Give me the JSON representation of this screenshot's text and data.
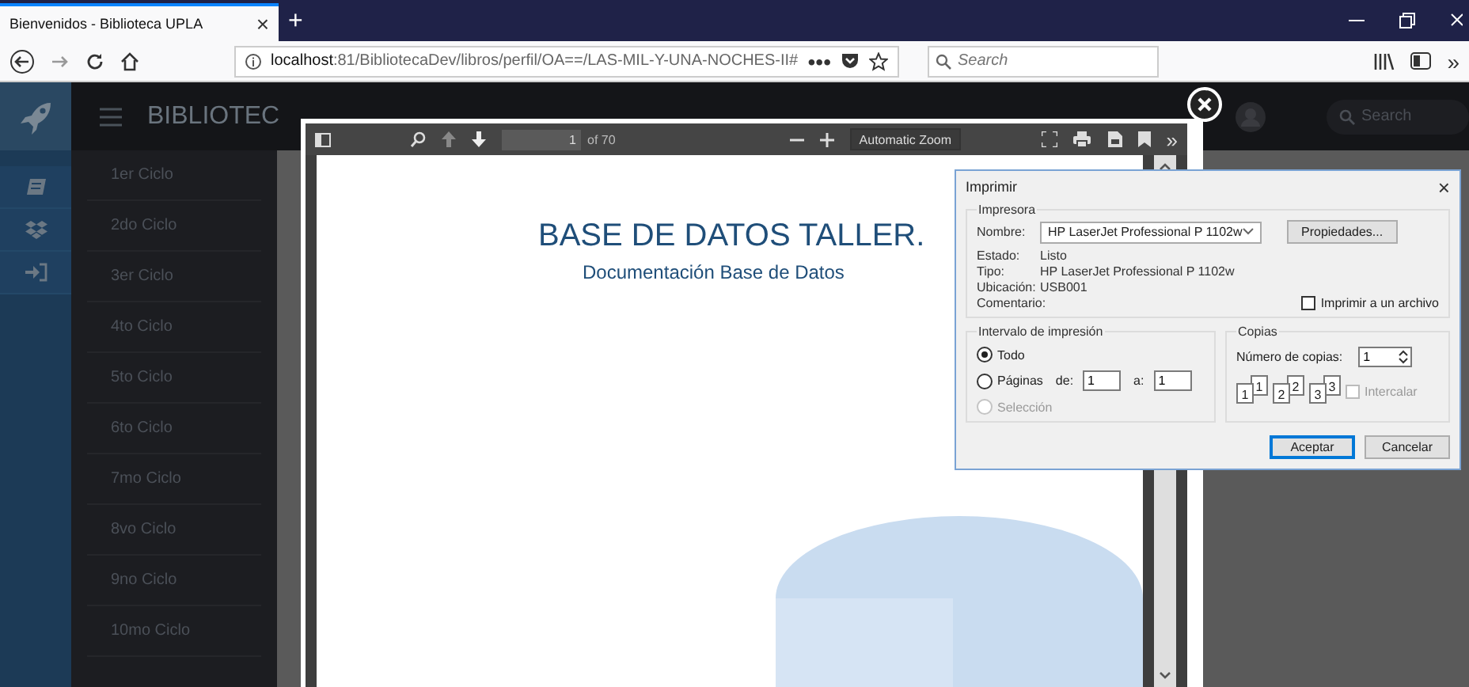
{
  "browser": {
    "tab": {
      "title": "Bienvenidos - Biblioteca UPLA",
      "close": "×"
    },
    "new_tab": "+",
    "url": "**localhost**:81/BibliotecaDev/libros/perfil/OA==/LAS-MIL-Y-UNA-NOCHES-II#",
    "more": "•••",
    "search": {
      "placeholder": "Search"
    },
    "overflow": "»"
  },
  "app": {
    "brand": "BIBLIOTEC",
    "search": {
      "placeholder": "Search"
    },
    "sidebar": {
      "items": [
        {
          "label": "1er Ciclo"
        },
        {
          "label": "2do Ciclo"
        },
        {
          "label": "3er Ciclo"
        },
        {
          "label": "4to Ciclo"
        },
        {
          "label": "5to Ciclo"
        },
        {
          "label": "6to Ciclo"
        },
        {
          "label": "7mo Ciclo"
        },
        {
          "label": "8vo Ciclo"
        },
        {
          "label": "9no Ciclo"
        },
        {
          "label": "10mo Ciclo"
        }
      ]
    }
  },
  "pdf_viewer": {
    "page_number": "1",
    "page_count": "of 70",
    "zoom": "Automatic Zoom",
    "more": "»",
    "document": {
      "title": "BASE DE DATOS TALLER.",
      "subtitle": "Documentación Base de Datos"
    }
  },
  "print_dialog": {
    "title": "Imprimir",
    "close": "×",
    "printer": {
      "group": "Impresora",
      "name_label": "Nombre:",
      "name": "HP LaserJet Professional P 1102w",
      "properties_button": "Propiedades...",
      "info": [
        {
          "label": "Estado:",
          "value": "Listo"
        },
        {
          "label": "Tipo:",
          "value": "HP LaserJet Professional P 1102w"
        },
        {
          "label": "Ubicación:",
          "value": "USB001"
        },
        {
          "label": "Comentario:"
        }
      ],
      "print_to_file": {
        "label": "Imprimir a un archivo",
        "checked": false
      }
    },
    "range": {
      "group": "Intervalo de impresión",
      "options": [
        {
          "label": "Todo",
          "selected": true,
          "disabled": false
        },
        {
          "label": "Páginas",
          "selected": false,
          "disabled": false
        },
        {
          "label": "Selección",
          "selected": false,
          "disabled": true
        }
      ],
      "from_label": "de:",
      "from": "1",
      "to_label": "a:",
      "to": "1"
    },
    "copies": {
      "group": "Copias",
      "label": "Número de copias:",
      "value": "1",
      "stacks": [
        {
          "back": "1",
          "front": "1"
        },
        {
          "back": "2",
          "front": "2"
        },
        {
          "back": "3",
          "front": "3"
        }
      ],
      "collate": {
        "label": "Intercalar",
        "checked": false,
        "disabled": true
      }
    },
    "buttons": [
      {
        "label": "Aceptar",
        "default": true
      },
      {
        "label": "Cancelar",
        "default": false
      }
    ]
  }
}
